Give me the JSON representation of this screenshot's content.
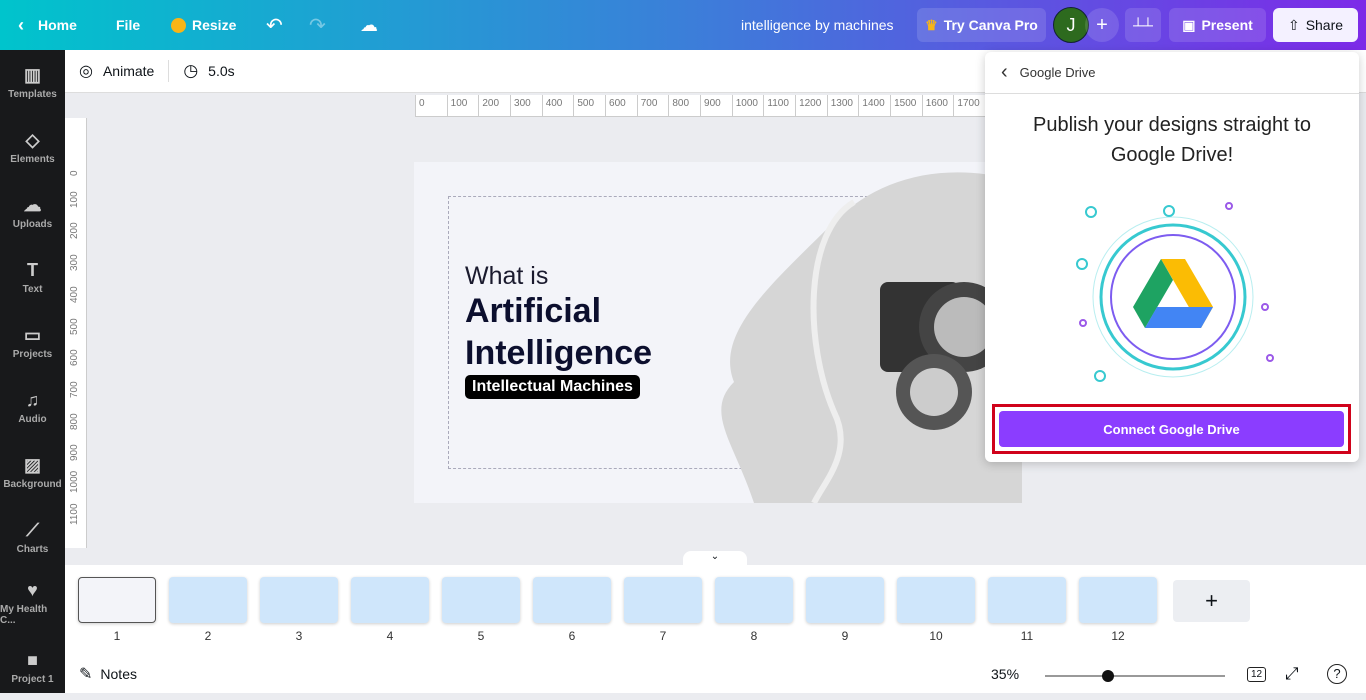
{
  "topbar": {
    "home": "Home",
    "file": "File",
    "resize": "Resize",
    "title": "intelligence by machines",
    "try_pro": "Try Canva Pro",
    "avatar": "J",
    "present": "Present",
    "share": "Share"
  },
  "sidebar": {
    "items": [
      {
        "label": "Templates",
        "icon": "▥"
      },
      {
        "label": "Elements",
        "icon": "◇"
      },
      {
        "label": "Uploads",
        "icon": "☁"
      },
      {
        "label": "Text",
        "icon": "T"
      },
      {
        "label": "Projects",
        "icon": "▭"
      },
      {
        "label": "Audio",
        "icon": "♫"
      },
      {
        "label": "Background",
        "icon": "▨"
      },
      {
        "label": "Charts",
        "icon": "⟋"
      },
      {
        "label": "My Health C...",
        "icon": "♥"
      },
      {
        "label": "Project 1",
        "icon": "■"
      }
    ]
  },
  "toolbar": {
    "animate": "Animate",
    "duration": "5.0s"
  },
  "ruler": {
    "h": [
      "0",
      "100",
      "200",
      "300",
      "400",
      "500",
      "600",
      "700",
      "800",
      "900",
      "1000",
      "1100",
      "1200",
      "1300",
      "1400",
      "1500",
      "1600",
      "1700"
    ],
    "v": [
      "0",
      "100",
      "200",
      "300",
      "400",
      "500",
      "600",
      "700",
      "800",
      "900",
      "1000",
      "1100"
    ]
  },
  "slide": {
    "line1": "What is",
    "line2": "Artificial",
    "line3": "Intelligence",
    "tag": "Intellectual Machines"
  },
  "panel": {
    "back_title": "Google Drive",
    "heading": "Publish your designs straight to Google Drive!",
    "connect": "Connect Google Drive",
    "highlight_color": "#d0021b",
    "button_color": "#8b3dff"
  },
  "pages": [
    "1",
    "2",
    "3",
    "4",
    "5",
    "6",
    "7",
    "8",
    "9",
    "10",
    "11",
    "12"
  ],
  "bottom": {
    "notes": "Notes",
    "zoom": "35%",
    "zoom_fraction": 0.35,
    "page_count": "12"
  }
}
